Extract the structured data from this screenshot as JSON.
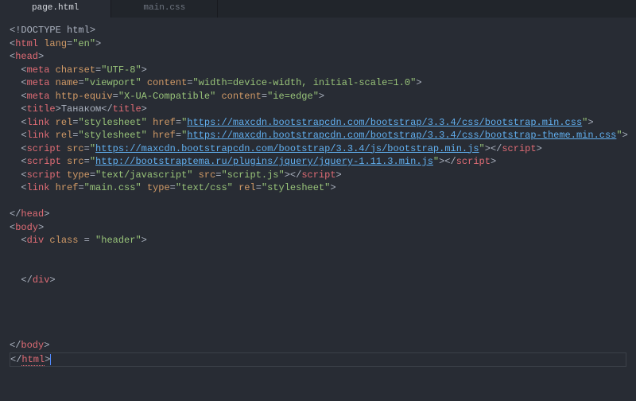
{
  "tabs": [
    {
      "label": "page.html",
      "active": true
    },
    {
      "label": "main.css",
      "active": false
    }
  ],
  "code": {
    "doctype": "<!DOCTYPE html>",
    "html_open": {
      "tag": "html",
      "attr": "lang",
      "val": "\"en\""
    },
    "head_open": {
      "tag": "head"
    },
    "meta1": {
      "tag": "meta",
      "attr": "charset",
      "val": "\"UTF-8\""
    },
    "meta2": {
      "tag": "meta",
      "attr1": "name",
      "val1": "\"viewport\"",
      "attr2": "content",
      "val2": "\"width=device-width, initial-scale=1.0\""
    },
    "meta3": {
      "tag": "meta",
      "attr1": "http-equiv",
      "val1": "\"X-UA-Compatible\"",
      "attr2": "content",
      "val2": "\"ie=edge\""
    },
    "title": {
      "tag": "title",
      "text": "Танаком"
    },
    "link1": {
      "tag": "link",
      "attr1": "rel",
      "val1": "\"stylesheet\"",
      "attr2": "href",
      "url": "https://maxcdn.bootstrapcdn.com/bootstrap/3.3.4/css/bootstrap.min.css"
    },
    "link2": {
      "tag": "link",
      "attr1": "rel",
      "val1": "\"stylesheet\"",
      "attr2": "href",
      "url": "https://maxcdn.bootstrapcdn.com/bootstrap/3.3.4/css/bootstrap-theme.min.css"
    },
    "script1": {
      "tag": "script",
      "attr": "src",
      "url": "https://maxcdn.bootstrapcdn.com/bootstrap/3.3.4/js/bootstrap.min.js"
    },
    "script2": {
      "tag": "script",
      "attr": "src",
      "url": "http://bootstraptema.ru/plugins/jquery/jquery-1.11.3.min.js"
    },
    "script3": {
      "tag": "script",
      "attr1": "type",
      "val1": "\"text/javascript\"",
      "attr2": "src",
      "val2": "\"script.js\""
    },
    "link3": {
      "tag": "link",
      "attr1": "href",
      "val1": "\"main.css\"",
      "attr2": "type",
      "val2": "\"text/css\"",
      "attr3": "rel",
      "val3": "\"stylesheet\""
    },
    "head_close": {
      "tag": "head"
    },
    "body_open": {
      "tag": "body"
    },
    "div_open": {
      "tag": "div",
      "attr": "class",
      "val": "\"header\""
    },
    "div_close": {
      "tag": "div"
    },
    "body_close": {
      "tag": "body"
    },
    "html_close": {
      "tag": "html"
    },
    "lt": "<",
    "gt": ">",
    "ltc": "</",
    "eq": "=",
    "q": "\"",
    "sp": " "
  }
}
